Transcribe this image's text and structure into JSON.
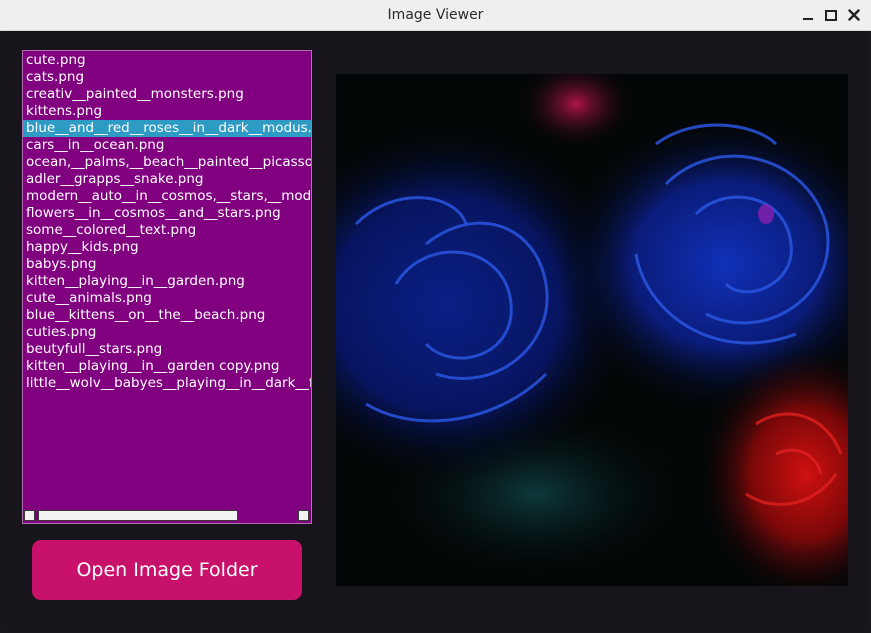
{
  "window": {
    "title": "Image Viewer",
    "controls": [
      "minimize-icon",
      "maximize-icon",
      "close-icon"
    ]
  },
  "file_list": {
    "items": [
      "cute.png",
      "cats.png",
      "creativ__painted__monsters.png",
      "kittens.png",
      "blue__and__red__roses__in__dark__modus.png",
      "cars__in__ocean.png",
      "ocean,__palms,__beach__painted__picasso.png",
      "adler__grapps__snake.png",
      "modern__auto__in__cosmos,__stars,__modern.png",
      "flowers__in__cosmos__and__stars.png",
      "some__colored__text.png",
      "happy__kids.png",
      "babys.png",
      "kitten__playing__in__garden.png",
      "cute__animals.png",
      "blue__kittens__on__the__beach.png",
      "cuties.png",
      "beutyfull__stars.png",
      "kitten__playing__in__garden copy.png",
      "little__wolv__babyes__playing__in__dark__forest.png"
    ],
    "selected_index": 4
  },
  "open_button": {
    "label": "Open Image Folder"
  },
  "colors": {
    "listbox_bg": "#800080",
    "selection": "#2e9bc4",
    "button_bg": "#c8116a",
    "window_bg": "#17141b"
  }
}
